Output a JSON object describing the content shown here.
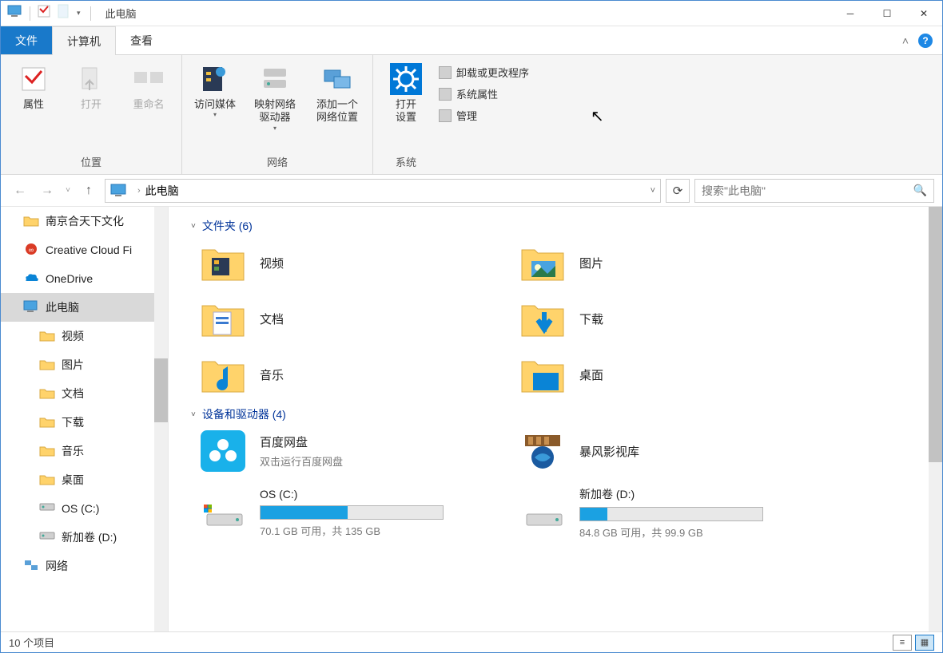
{
  "window": {
    "title": "此电脑"
  },
  "ribbon": {
    "file": "文件",
    "tabs": [
      "计算机",
      "查看"
    ],
    "groups": {
      "location": {
        "label": "位置",
        "properties": "属性",
        "open": "打开",
        "rename": "重命名"
      },
      "network": {
        "label": "网络",
        "media": "访问媒体",
        "map": "映射网络\n驱动器",
        "addloc": "添加一个\n网络位置"
      },
      "system": {
        "label": "系统",
        "open_settings": "打开\n设置",
        "uninstall": "卸载或更改程序",
        "props": "系统属性",
        "manage": "管理"
      }
    }
  },
  "nav": {
    "breadcrumb": "此电脑",
    "search_placeholder": "搜索\"此电脑\""
  },
  "sidebar": {
    "items": [
      {
        "label": "南京合天下文化"
      },
      {
        "label": "Creative Cloud Fi"
      },
      {
        "label": "OneDrive"
      },
      {
        "label": "此电脑",
        "selected": true
      },
      {
        "label": "视频",
        "child": true
      },
      {
        "label": "图片",
        "child": true
      },
      {
        "label": "文档",
        "child": true
      },
      {
        "label": "下载",
        "child": true
      },
      {
        "label": "音乐",
        "child": true
      },
      {
        "label": "桌面",
        "child": true
      },
      {
        "label": "OS (C:)",
        "child": true
      },
      {
        "label": "新加卷 (D:)",
        "child": true
      },
      {
        "label": "网络"
      }
    ]
  },
  "content": {
    "folders_header": "文件夹 (6)",
    "folders": [
      {
        "name": "视频",
        "icon": "videos"
      },
      {
        "name": "图片",
        "icon": "pictures"
      },
      {
        "name": "文档",
        "icon": "documents"
      },
      {
        "name": "下载",
        "icon": "downloads"
      },
      {
        "name": "音乐",
        "icon": "music"
      },
      {
        "name": "桌面",
        "icon": "desktop"
      }
    ],
    "devices_header": "设备和驱动器 (4)",
    "apps": [
      {
        "name": "百度网盘",
        "sub": "双击运行百度网盘"
      },
      {
        "name": "暴风影视库",
        "sub": ""
      }
    ],
    "drives": [
      {
        "name": "OS (C:)",
        "free": "70.1 GB 可用，共 135 GB",
        "fill_pct": 48
      },
      {
        "name": "新加卷 (D:)",
        "free": "84.8 GB 可用，共 99.9 GB",
        "fill_pct": 15
      }
    ]
  },
  "status": {
    "items": "10 个项目"
  }
}
